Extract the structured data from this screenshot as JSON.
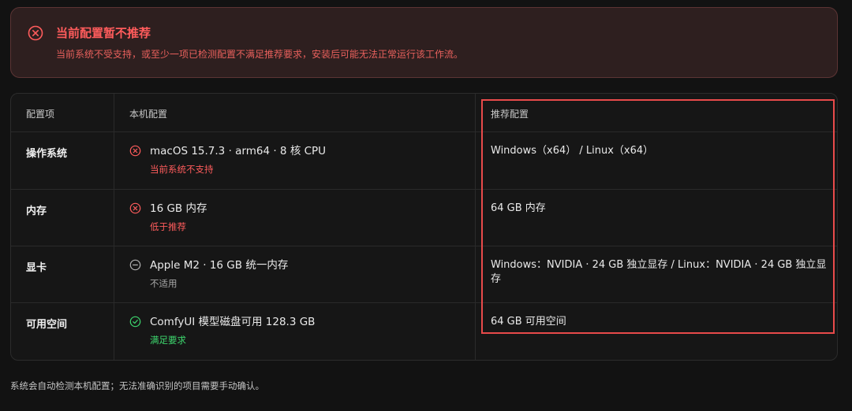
{
  "alert": {
    "icon": "x-circle-icon",
    "title": "当前配置暂不推荐",
    "description": "当前系统不受支持，或至少一项已检测配置不满足推荐要求，安装后可能无法正常运行该工作流。",
    "color": "#ff5c5c"
  },
  "table": {
    "headers": [
      "配置项",
      "本机配置",
      "推荐配置"
    ],
    "rows": [
      {
        "item": "操作系统",
        "status": "fail",
        "status_icon": "x-circle-icon",
        "local_value": "macOS 15.7.3 · arm64 · 8 核 CPU",
        "local_note": "当前系统不支持",
        "recommended": "Windows（x64） / Linux（x64）"
      },
      {
        "item": "内存",
        "status": "fail",
        "status_icon": "x-circle-icon",
        "local_value": "16 GB 内存",
        "local_note": "低于推荐",
        "recommended": "64 GB 内存"
      },
      {
        "item": "显卡",
        "status": "na",
        "status_icon": "minus-circle-icon",
        "local_value": "Apple M2 · 16 GB 统一内存",
        "local_note": "不适用",
        "recommended": "Windows：NVIDIA · 24 GB 独立显存 / Linux：NVIDIA · 24 GB 独立显存"
      },
      {
        "item": "可用空间",
        "status": "pass",
        "status_icon": "check-circle-icon",
        "local_value": "ComfyUI 模型磁盘可用 128.3 GB",
        "local_note": "满足要求",
        "recommended": "64 GB 可用空间"
      }
    ]
  },
  "footnote": "系统会自动检测本机配置；无法准确识别的项目需要手动确认。",
  "colors": {
    "fail": "#ff5c5c",
    "na": "#a8a8a8",
    "pass": "#3dd56d",
    "highlight": "#e84a4a"
  }
}
